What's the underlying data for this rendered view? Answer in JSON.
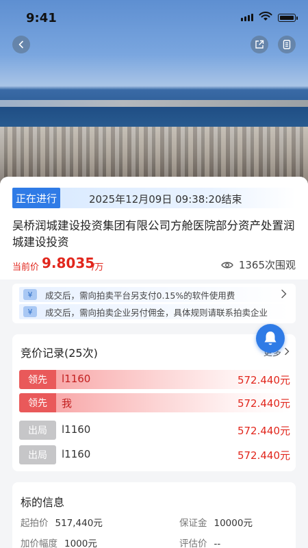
{
  "status_bar": {
    "time": "9:41"
  },
  "header": {
    "back_icon": "chevron-left-icon",
    "share_icon": "share-icon",
    "doc_icon": "document-icon"
  },
  "auction": {
    "status": "正在进行",
    "end_time": "2025年12月09日 09:38:20结束",
    "title": "吴桥润城建设投资集团有限公司方舱医院部分资产处置润城建设投资",
    "price_label": "当前价",
    "price_value": "9.8035",
    "price_unit": "/万",
    "views": "1365次围观"
  },
  "notices": [
    {
      "text": "成交后，需向拍卖平台另支付0.15%的软件使用费",
      "icon": "yen"
    },
    {
      "text": "成交后，需向拍卖企业另付佣金，具体规则请联系拍卖企业",
      "icon": "yen"
    }
  ],
  "bid_records": {
    "title": "竞价记录(25次)",
    "more_label": "更多",
    "rows": [
      {
        "status": "领先",
        "user": "l1160",
        "amount": "572.440元",
        "kind": "lead"
      },
      {
        "status": "领先",
        "user": "我",
        "amount": "572.440元",
        "kind": "lead"
      },
      {
        "status": "出局",
        "user": "l1160",
        "amount": "572.440元",
        "kind": "out"
      },
      {
        "status": "出局",
        "user": "l1160",
        "amount": "572.440元",
        "kind": "out"
      }
    ]
  },
  "target_info": {
    "title": "标的信息",
    "start_price_label": "起拍价",
    "start_price": "517,440元",
    "deposit_label": "保证金",
    "deposit": "10000元",
    "increment_label": "加价幅度",
    "increment": "1000元",
    "appraisal_label": "评估价",
    "appraisal": "--"
  },
  "colors": {
    "accent": "#2f7be6",
    "price": "#e1261c",
    "lead": "#e9595a",
    "out": "#c6c6c8"
  }
}
